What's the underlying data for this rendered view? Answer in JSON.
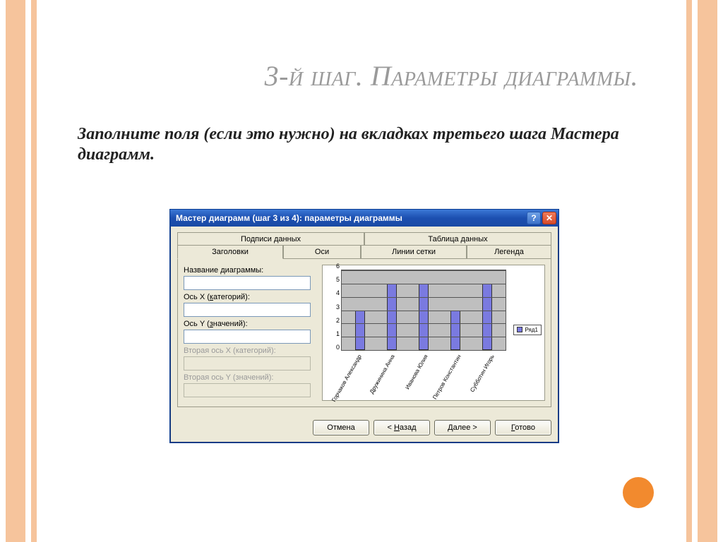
{
  "slide": {
    "title": "3-й шаг. Параметры диаграммы.",
    "subtitle": "Заполните поля (если это нужно) на вкладках третьего шага Мастера диаграмм."
  },
  "dialog": {
    "title": "Мастер диаграмм (шаг 3 из 4): параметры диаграммы",
    "tabs_top": [
      "Подписи данных",
      "Таблица данных"
    ],
    "tabs_bottom": [
      "Заголовки",
      "Оси",
      "Линии сетки",
      "Легенда"
    ],
    "active_tab": "Заголовки",
    "fields": {
      "chart_title_label": "Название диаграммы:",
      "chart_title_value": "",
      "x_axis_label": "Ось X (категорий):",
      "x_axis_value": "",
      "y_axis_label": "Ось Y (значений):",
      "y_axis_value": "",
      "x2_axis_label": "Вторая ось X (категорий):",
      "x2_axis_value": "",
      "y2_axis_label": "Вторая ось Y (значений):",
      "y2_axis_value": ""
    },
    "legend_label": "Ряд1",
    "buttons": {
      "cancel": "Отмена",
      "back": "< Назад",
      "next": "Далее >",
      "finish": "Готово"
    }
  },
  "chart_data": {
    "type": "bar",
    "categories": [
      "Горчаков Александр",
      "Дружинина Анна",
      "Иванова Юлия",
      "Петров Константин",
      "Субботин Игорь"
    ],
    "values": [
      3,
      5,
      5,
      3,
      5
    ],
    "series_name": "Ряд1",
    "ylim": [
      0,
      6
    ],
    "yticks": [
      0,
      1,
      2,
      3,
      4,
      5,
      6
    ],
    "title": "",
    "xlabel": "",
    "ylabel": ""
  }
}
